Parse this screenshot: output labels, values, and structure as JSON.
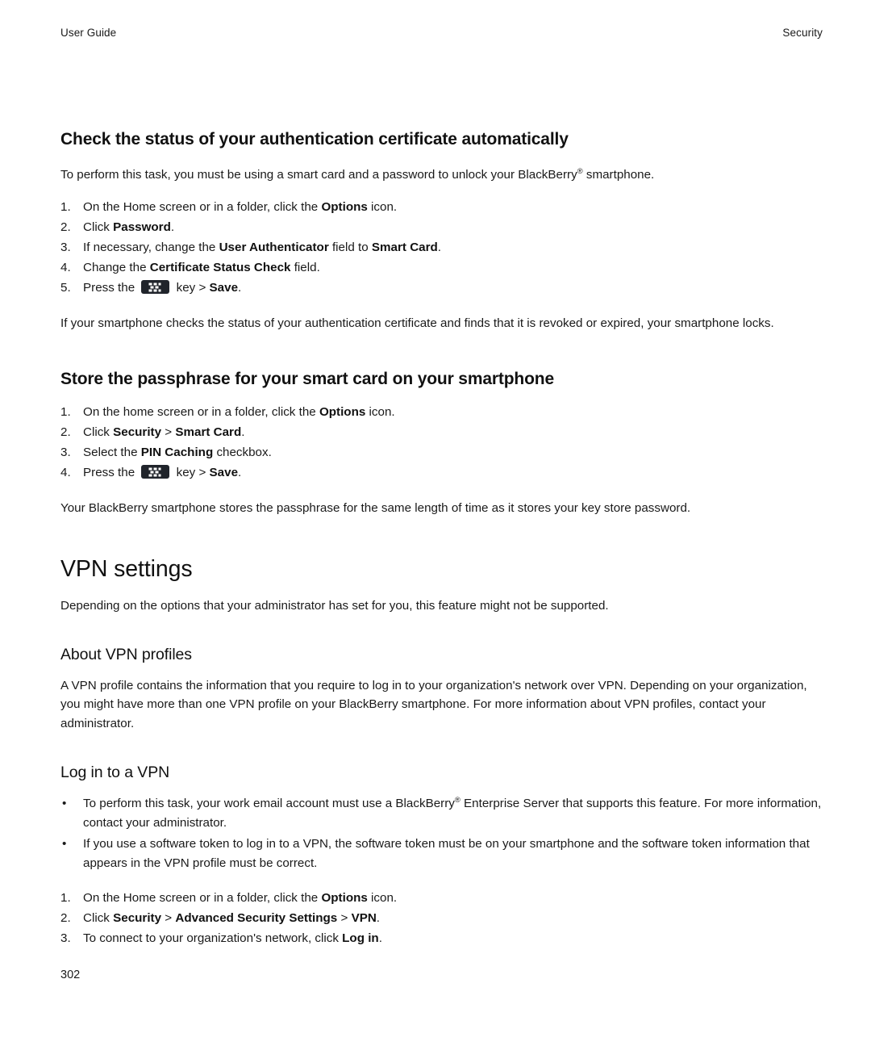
{
  "header": {
    "left": "User Guide",
    "right": "Security"
  },
  "sections": {
    "cert_check": {
      "heading": "Check the status of your authentication certificate automatically",
      "intro_pre": "To perform this task, you must be using a smart card and a password to unlock your BlackBerry",
      "intro_reg": "®",
      "intro_post": " smartphone.",
      "steps": [
        {
          "num": "1.",
          "pre": "On the Home screen or in a folder, click the ",
          "bold": "Options",
          "post": " icon."
        },
        {
          "num": "2.",
          "pre": "Click ",
          "bold": "Password",
          "post": "."
        },
        {
          "num": "3.",
          "pre": "If necessary, change the ",
          "bold": "User Authenticator",
          "mid": " field to ",
          "bold2": "Smart Card",
          "post": "."
        },
        {
          "num": "4.",
          "pre": "Change the ",
          "bold": "Certificate Status Check",
          "post": " field."
        },
        {
          "num": "5.",
          "pre": "Press the ",
          "icon": "blackberry-menu-key",
          "mid": " key > ",
          "bold2": "Save",
          "post": "."
        }
      ],
      "outro": "If your smartphone checks the status of your authentication certificate and finds that it is revoked or expired, your smartphone locks."
    },
    "store_passphrase": {
      "heading": "Store the passphrase for your smart card on your smartphone",
      "steps": [
        {
          "num": "1.",
          "pre": "On the home screen or in a folder, click the ",
          "bold": "Options",
          "post": " icon."
        },
        {
          "num": "2.",
          "pre": "Click ",
          "bold": "Security",
          "mid": " > ",
          "bold2": "Smart Card",
          "post": "."
        },
        {
          "num": "3.",
          "pre": "Select the ",
          "bold": "PIN Caching",
          "post": " checkbox."
        },
        {
          "num": "4.",
          "pre": "Press the ",
          "icon": "blackberry-menu-key",
          "mid": " key > ",
          "bold2": "Save",
          "post": "."
        }
      ],
      "outro": "Your BlackBerry smartphone stores the passphrase for the same length of time as it stores your key store password."
    },
    "vpn_settings": {
      "heading": "VPN settings",
      "intro": "Depending on the options that your administrator has set for you, this feature might not be supported."
    },
    "about_vpn_profiles": {
      "heading": "About VPN profiles",
      "body": "A VPN profile contains the information that you require to log in to your organization's network over VPN. Depending on your organization, you might have more than one VPN profile on your BlackBerry smartphone. For more information about VPN profiles, contact your administrator."
    },
    "log_in_to_vpn": {
      "heading": "Log in to a VPN",
      "bullets": [
        {
          "marker": "•",
          "pre": "To perform this task, your work email account must use a BlackBerry",
          "reg": "®",
          "post": " Enterprise Server that supports this feature. For more information, contact your administrator."
        },
        {
          "marker": "•",
          "pre": "If you use a software token to log in to a VPN, the software token must be on your smartphone and the software token information that appears in the VPN profile must be correct.",
          "reg": "",
          "post": ""
        }
      ],
      "steps": [
        {
          "num": "1.",
          "pre": "On the Home screen or in a folder, click the ",
          "bold": "Options",
          "post": " icon."
        },
        {
          "num": "2.",
          "pre": "Click ",
          "bold": "Security",
          "mid": " > ",
          "bold2": "Advanced Security Settings",
          "mid2": " > ",
          "bold3": "VPN",
          "post": "."
        },
        {
          "num": "3.",
          "pre": "To connect to your organization's network, click ",
          "bold": "Log in",
          "post": "."
        }
      ]
    }
  },
  "footer": {
    "page_number": "302"
  }
}
